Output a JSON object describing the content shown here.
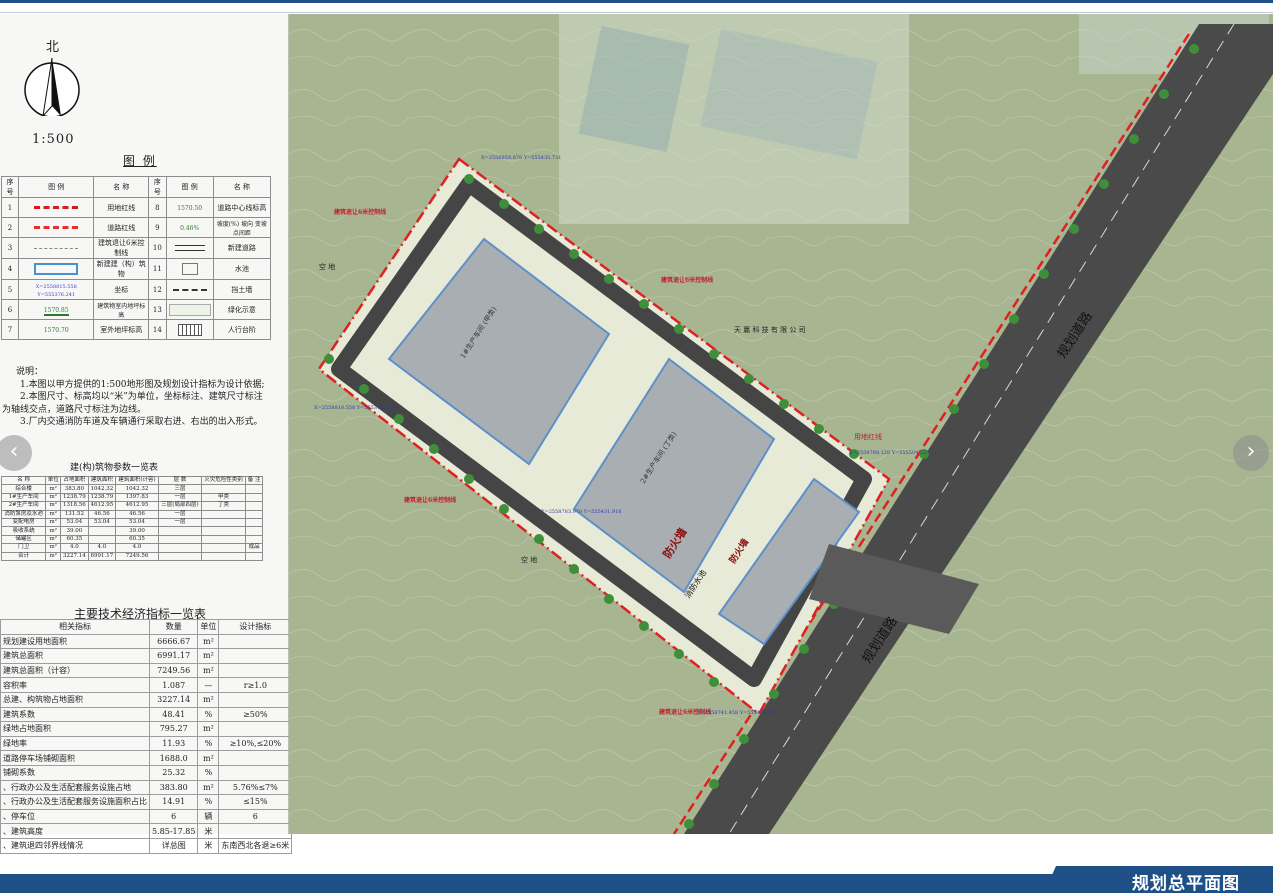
{
  "page": {
    "title": "规划总平面图",
    "colors": {
      "accent": "#1e4f86",
      "redline": "#e02020",
      "building": "#a9aeb3",
      "road": "#4a4a4a"
    }
  },
  "north": {
    "label": "北",
    "scale": "1:500"
  },
  "legend": {
    "title": "图 例",
    "headers": [
      "序号",
      "图 例",
      "名 称",
      "序号",
      "图 例",
      "名 称"
    ],
    "rows": [
      {
        "n1": "1",
        "name1": "用地红线",
        "n2": "8",
        "sym2": "1570.50",
        "name2": "道路中心线标高"
      },
      {
        "n1": "2",
        "name1": "道路红线",
        "n2": "9",
        "sym2": "0.46%",
        "name2": "坡度(%) 坡向 变坡点间距"
      },
      {
        "n1": "3",
        "name1": "建筑退让6米控制线",
        "n2": "10",
        "sym2": "",
        "name2": "新建道路"
      },
      {
        "n1": "4",
        "name1": "新建建（构）筑物",
        "n2": "11",
        "sym2": "",
        "name2": "水池"
      },
      {
        "n1": "5",
        "sym1": "X=2558815.558 Y=555376.241",
        "name1": "坐标",
        "n2": "12",
        "sym2": "",
        "name2": "挡土墙"
      },
      {
        "n1": "6",
        "sym1": "1570.85",
        "name1": "建筑物室内地坪标高",
        "n2": "13",
        "sym2": "",
        "name2": "绿化示意"
      },
      {
        "n1": "7",
        "sym1": "1570.70",
        "name1": "室外地坪标高",
        "n2": "14",
        "sym2": "",
        "name2": "人行台阶"
      }
    ]
  },
  "notes": {
    "title": "说明：",
    "lines": [
      "1.本图以甲方提供的1:500地形图及规划设计指标为设计依据;",
      "2.本图尺寸、标高均以“米”为单位，坐标标注、建筑尺寸标注",
      "为轴线交点，道路尺寸标注为边线。",
      "3.厂内交通消防车道及车辆通行采取右进、右出的出入形式。"
    ]
  },
  "building_table": {
    "title": "建(构)筑物参数一览表",
    "headers": [
      "名 称",
      "单位",
      "占地面积",
      "建筑面积",
      "建筑面积(计容)",
      "层 数",
      "火灾危险性类别",
      "备 注"
    ],
    "rows": [
      [
        "综合楼",
        "m²",
        "383.80",
        "1042.32",
        "1042.32",
        "三层",
        "",
        ""
      ],
      [
        "1#生产车间",
        "m²",
        "1238.79",
        "1238.79",
        "1397.83",
        "一层",
        "甲类",
        ""
      ],
      [
        "2#生产车间",
        "m²",
        "1318.56",
        "4612.95",
        "4612.95",
        "三层(局部四层)",
        "丁类",
        ""
      ],
      [
        "消防泵房及水池",
        "m²",
        "131.52",
        "46.56",
        "46.56",
        "一层",
        "",
        ""
      ],
      [
        "变配电房",
        "m²",
        "53.04",
        "53.04",
        "53.04",
        "一层",
        "",
        ""
      ],
      [
        "吸收系统",
        "m²",
        "39.00",
        "",
        "39.00",
        "",
        "",
        ""
      ],
      [
        "储罐区",
        "m²",
        "60.35",
        "",
        "60.35",
        "",
        "",
        ""
      ],
      [
        "门卫",
        "m²",
        "4.0",
        "4.0",
        "4.0",
        "",
        "",
        "成品"
      ],
      [
        "合计",
        "m²",
        "3227.14",
        "6991.17",
        "7249.56",
        "",
        "",
        ""
      ]
    ]
  },
  "econ_table": {
    "title": "主要技术经济指标一览表",
    "headers": [
      "相关指标",
      "数量",
      "单位",
      "设计指标"
    ],
    "rows": [
      [
        "规划建设用地面积",
        "6666.67",
        "m²",
        ""
      ],
      [
        "建筑总面积",
        "6991.17",
        "m²",
        ""
      ],
      [
        "建筑总面积（计容）",
        "7249.56",
        "m²",
        ""
      ],
      [
        "容积率",
        "1.087",
        "—",
        "r≥1.0"
      ],
      [
        "总建、构筑物占地面积",
        "3227.14",
        "m²",
        ""
      ],
      [
        "建筑系数",
        "48.41",
        "%",
        "≥50%"
      ],
      [
        "绿地占地面积",
        "795.27",
        "m²",
        ""
      ],
      [
        "绿地率",
        "11.93",
        "%",
        "≥10%,≤20%"
      ],
      [
        "道路停车场铺砌面积",
        "1688.0",
        "m²",
        ""
      ],
      [
        "铺砌系数",
        "25.32",
        "%",
        ""
      ],
      [
        "、行政办公及生活配套服务设施占地",
        "383.80",
        "m²",
        "5.76%≤7%"
      ],
      [
        "、行政办公及生活配套服务设施面积占比",
        "14.91",
        "%",
        "≤15%"
      ],
      [
        "、停车位",
        "6",
        "辆",
        "6"
      ],
      [
        "、建筑高度",
        "5.85-17.85",
        "米",
        ""
      ],
      [
        "、建筑退四邻界线情况",
        "详总图",
        "米",
        "东南西北各退≥6米"
      ]
    ]
  },
  "map": {
    "labels": {
      "road_upper": "规划道路",
      "road_lower": "规划道路",
      "neighbor": "天 赢 科 技 有 限 公 司",
      "vacant1": "空 地",
      "vacant2": "空 地",
      "redline_label": "用地红线",
      "setback1": "建筑退让6米控制线",
      "setback2": "建筑退让6米控制线",
      "setback3": "建筑退让6米控制线",
      "setback4": "建筑退让6米控制线",
      "coord1": "X=2558859.878 Y=555435.731",
      "coord2": "X=2558818.558 Y=555376.241",
      "coord3": "X=2558783.978 Y=555431.918",
      "coord4": "X=2558788.128 Y=555504.229",
      "coord5": "X=2558741.458 Y=555474.435",
      "firewall1": "防火墙",
      "firewall2": "防火墙",
      "pump": "消防水池",
      "bldg1": "1#生产车间 (甲类)",
      "bldg2": "2#生产车间 (丁类)"
    }
  },
  "nav": {
    "prev": "‹",
    "next": "›"
  }
}
